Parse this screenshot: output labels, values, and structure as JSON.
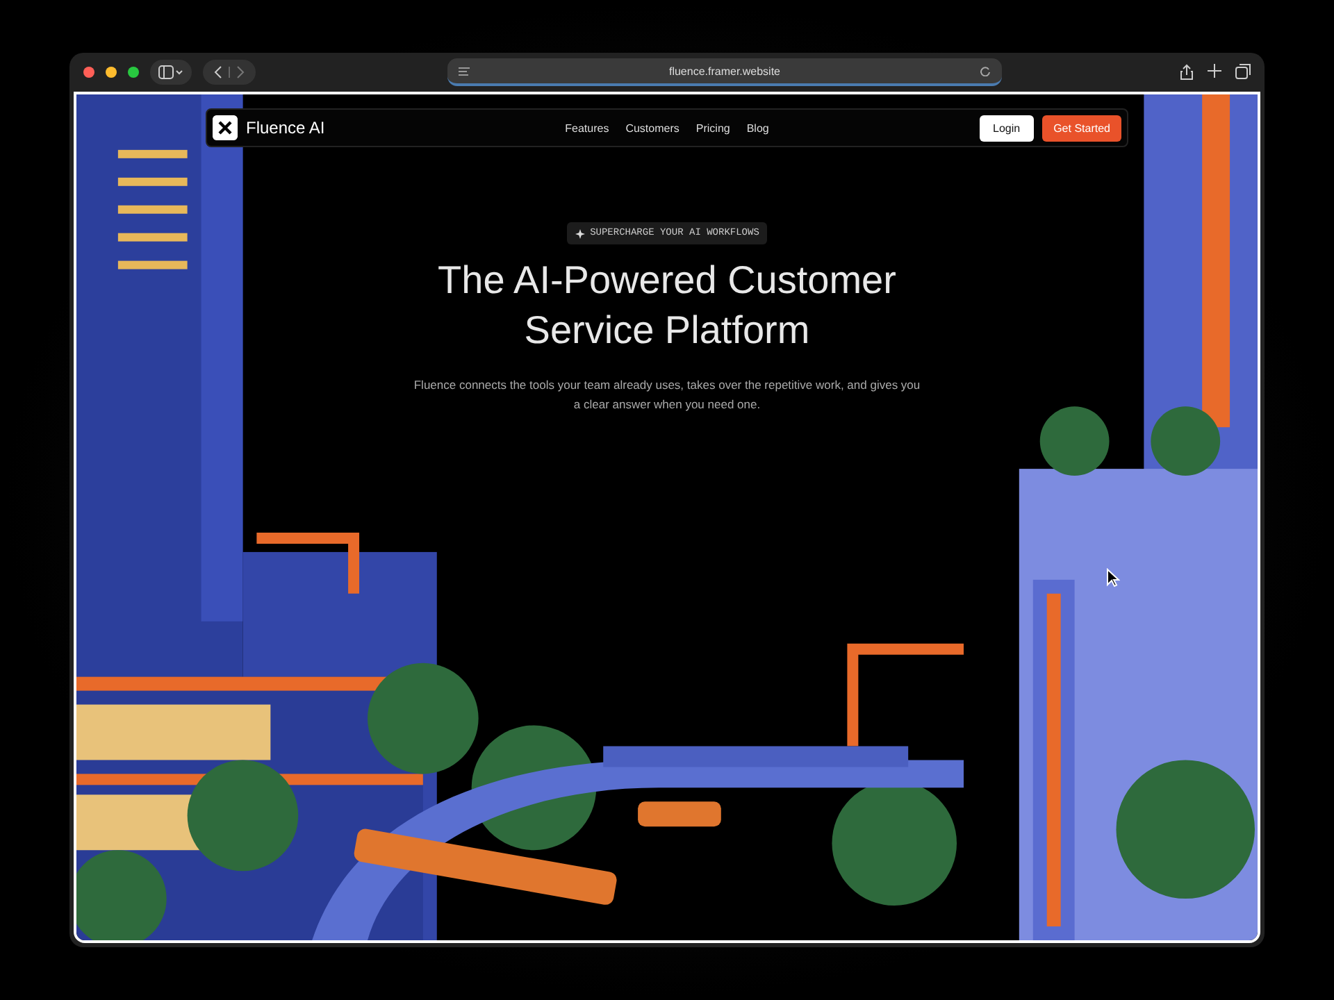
{
  "browser": {
    "url": "fluence.framer.website"
  },
  "nav": {
    "brand": "Fluence AI",
    "links": [
      "Features",
      "Customers",
      "Pricing",
      "Blog"
    ],
    "login": "Login",
    "cta": "Get Started"
  },
  "hero": {
    "badge": "SUPERCHARGE YOUR AI WORKFLOWS",
    "title_lines": [
      "The AI-Powered Customer",
      "Service Platform"
    ],
    "subtitle": "Fluence connects the tools your team already uses, takes over the repetitive work, and gives you a clear answer when you need one."
  }
}
